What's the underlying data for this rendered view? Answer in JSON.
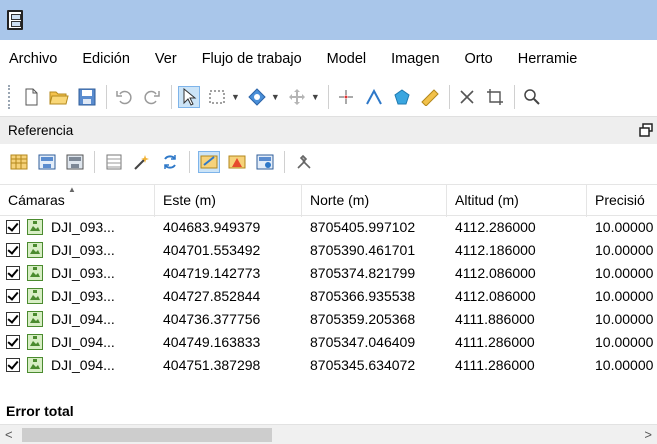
{
  "menubar": {
    "items": [
      "Archivo",
      "Edición",
      "Ver",
      "Flujo de trabajo",
      "Model",
      "Imagen",
      "Orto",
      "Herramie"
    ]
  },
  "panel": {
    "title": "Referencia"
  },
  "table": {
    "columns": [
      "Cámaras",
      "Este (m)",
      "Norte (m)",
      "Altitud (m)",
      "Precisió"
    ],
    "rows": [
      {
        "name": "DJI_093...",
        "este": "404683.949379",
        "norte": "8705405.997102",
        "altitud": "4112.286000",
        "precision": "10.00000"
      },
      {
        "name": "DJI_093...",
        "este": "404701.553492",
        "norte": "8705390.461701",
        "altitud": "4112.186000",
        "precision": "10.00000"
      },
      {
        "name": "DJI_093...",
        "este": "404719.142773",
        "norte": "8705374.821799",
        "altitud": "4112.086000",
        "precision": "10.00000"
      },
      {
        "name": "DJI_093...",
        "este": "404727.852844",
        "norte": "8705366.935538",
        "altitud": "4112.086000",
        "precision": "10.00000"
      },
      {
        "name": "DJI_094...",
        "este": "404736.377756",
        "norte": "8705359.205368",
        "altitud": "4111.886000",
        "precision": "10.00000"
      },
      {
        "name": "DJI_094...",
        "este": "404749.163833",
        "norte": "8705347.046409",
        "altitud": "4111.286000",
        "precision": "10.00000"
      },
      {
        "name": "DJI_094...",
        "este": "404751.387298",
        "norte": "8705345.634072",
        "altitud": "4111.286000",
        "precision": "10.00000"
      }
    ],
    "footer": "Error total"
  },
  "icons": {
    "title": "app-film-icon",
    "toolbar": [
      "new-document-icon",
      "open-folder-icon",
      "save-icon",
      "undo-icon",
      "redo-icon",
      "pointer-select-icon",
      "rectangle-select-icon",
      "navigate-icon",
      "move-icon",
      "center-crosshair-icon",
      "ruler-angle-icon",
      "shape-icon",
      "measure-ruler-icon",
      "delete-x-icon",
      "crop-icon",
      "zoom-icon"
    ],
    "panel": [
      "import-cameras-icon",
      "export-cameras-icon",
      "import-markers-icon",
      "table-view-icon",
      "wand-icon",
      "refresh-icon",
      "camera-ref-icon",
      "warning-ref-icon",
      "settings-ref-icon",
      "tools-icon"
    ]
  },
  "colors": {
    "titlebar": "#a9c6ea",
    "active_tool": "#cce4f7"
  }
}
